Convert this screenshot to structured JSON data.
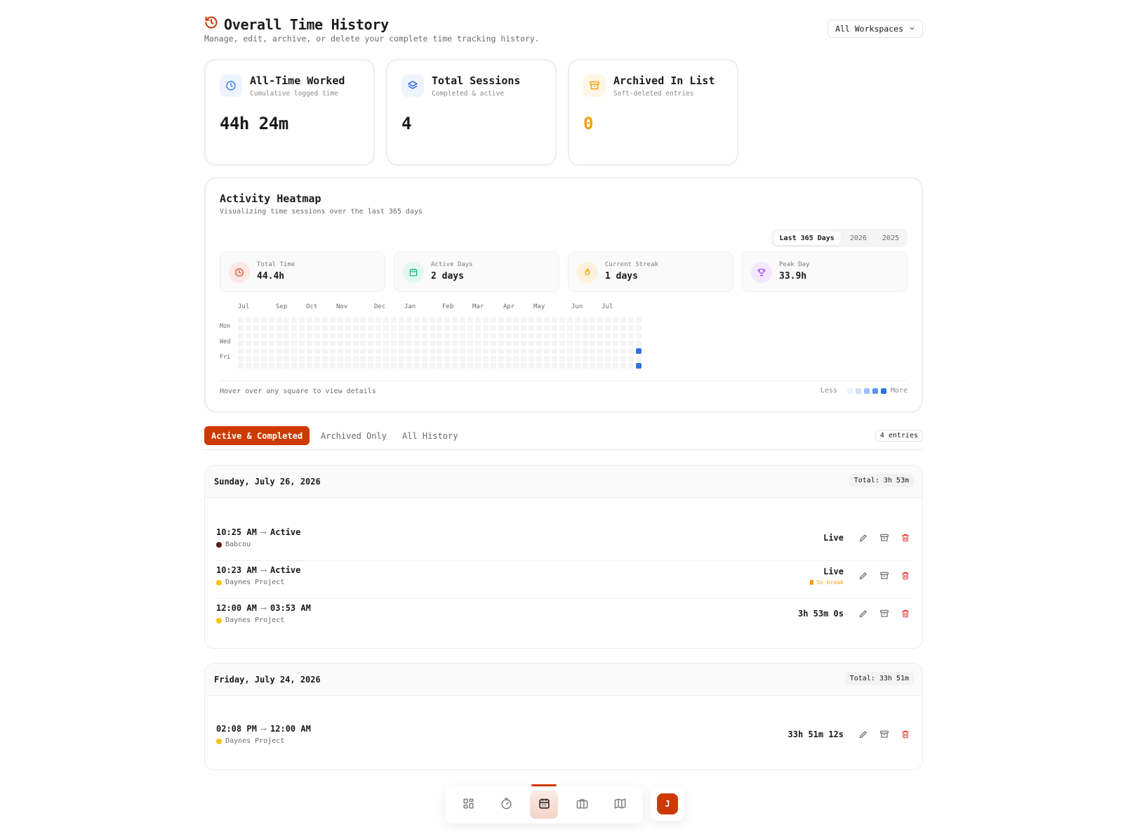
{
  "header": {
    "title": "Overall Time History",
    "subtitle": "Manage, edit, archive, or delete your complete time tracking history.",
    "workspace_select": "All Workspaces"
  },
  "stats": [
    {
      "label": "All-Time Worked",
      "sublabel": "Cumulative logged time",
      "value": "44h 24m",
      "icon": "clock-icon",
      "color": "#3b82f6",
      "bg": "#eef4ff"
    },
    {
      "label": "Total Sessions",
      "sublabel": "Completed & active",
      "value": "4",
      "icon": "layers-icon",
      "color": "#2563eb",
      "bg": "#eef3fc"
    },
    {
      "label": "Archived In List",
      "sublabel": "Soft-deleted entries",
      "value": "0",
      "icon": "archive-icon",
      "color": "#f59e0b",
      "bg": "#fff6e6",
      "value_color": "#f59e0b"
    }
  ],
  "heatmap": {
    "title": "Activity Heatmap",
    "subtitle": "Visualizing time sessions over the last 365 days",
    "ranges": [
      "Last 365 Days",
      "2026",
      "2025"
    ],
    "active_range": "Last 365 Days",
    "mini_stats": [
      {
        "label": "Total Time",
        "value": "44.4h",
        "icon": "clock-icon",
        "color": "#dc4a2c",
        "bg": "#fde9e3"
      },
      {
        "label": "Active Days",
        "value": "2 days",
        "icon": "calendar-icon",
        "color": "#10b981",
        "bg": "#e3f8ef"
      },
      {
        "label": "Current Streak",
        "value": "1 days",
        "icon": "flame-icon",
        "color": "#f59e0b",
        "bg": "#fff2dd"
      },
      {
        "label": "Peak Day",
        "value": "33.9h",
        "icon": "trophy-icon",
        "color": "#a855f7",
        "bg": "#f3e8ff"
      }
    ],
    "months": [
      "Jul",
      "Sep",
      "Oct",
      "Nov",
      "Dec",
      "Jan",
      "Feb",
      "Mar",
      "Apr",
      "May",
      "Jun",
      "Jul"
    ],
    "day_labels": [
      "Mon",
      "Wed",
      "Fri"
    ],
    "hint": "Hover over any square to view details",
    "legend_less": "Less",
    "legend_more": "More",
    "legend_colors": [
      "#f4f4f4",
      "#cfe0fb",
      "#9dc0f6",
      "#5b93ec",
      "#2f73e0"
    ],
    "active_cells": [
      {
        "date": "2026-07-24",
        "hours": 33.9
      },
      {
        "date": "2026-07-26",
        "hours": 3.9
      }
    ]
  },
  "tabs": {
    "items": [
      "Active & Completed",
      "Archived Only",
      "All History"
    ],
    "active": "Active & Completed",
    "entries": "4 entries"
  },
  "groups": [
    {
      "date": "Sunday, July 26, 2026",
      "total": "Total: 3h 53m",
      "rows": [
        {
          "start": "10:25 AM",
          "end": "Active",
          "project": "Babcou",
          "dot": "#5a1a0c",
          "duration": "Live",
          "break": ""
        },
        {
          "start": "10:23 AM",
          "end": "Active",
          "project": "Daynes Project",
          "dot": "#f5c518",
          "duration": "Live",
          "break": "5s break"
        },
        {
          "start": "12:00 AM",
          "end": "03:53 AM",
          "project": "Daynes Project",
          "dot": "#f5c518",
          "duration": "3h 53m 0s",
          "break": ""
        }
      ]
    },
    {
      "date": "Friday, July 24, 2026",
      "total": "Total: 33h 51m",
      "rows": [
        {
          "start": "02:08 PM",
          "end": "12:00 AM",
          "project": "Daynes Project",
          "dot": "#f5c518",
          "duration": "33h 51m 12s",
          "break": ""
        }
      ]
    }
  ],
  "nav": {
    "items": [
      "grid-icon",
      "timer-icon",
      "calendar-icon",
      "briefcase-icon",
      "map-icon"
    ],
    "active": "calendar-icon",
    "avatar_initial": "J"
  },
  "colors": {
    "accent": "#cc3a00"
  }
}
